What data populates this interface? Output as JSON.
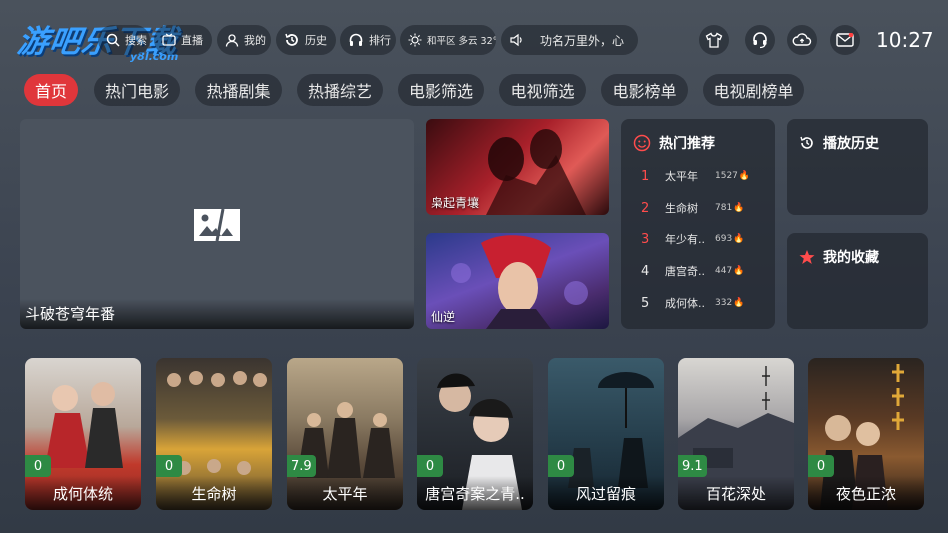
{
  "logo": {
    "main": "游吧乐下载",
    "sub": "y8l.com"
  },
  "topbar": {
    "search_label": "搜索",
    "live_label": "直播",
    "mine_label": "我的",
    "history_label": "历史",
    "rank_label": "排行",
    "weather_label": "和平区 多云 32°",
    "notice_text": "功名万里外，心"
  },
  "clock": "10:27",
  "nav": [
    {
      "label": "首页"
    },
    {
      "label": "热门电影"
    },
    {
      "label": "热播剧集"
    },
    {
      "label": "热播综艺"
    },
    {
      "label": "电影筛选"
    },
    {
      "label": "电视筛选"
    },
    {
      "label": "电影榜单"
    },
    {
      "label": "电视剧榜单"
    }
  ],
  "feature": {
    "caption": "斗破苍穹年番"
  },
  "thumbs": [
    {
      "caption": "枭起青壤"
    },
    {
      "caption": "仙逆"
    }
  ],
  "hot": {
    "title": "热门推荐",
    "items": [
      {
        "rank": "1",
        "name": "太平年",
        "count": "1527"
      },
      {
        "rank": "2",
        "name": "生命树",
        "count": "781"
      },
      {
        "rank": "3",
        "name": "年少有..",
        "count": "693"
      },
      {
        "rank": "4",
        "name": "唐宫奇..",
        "count": "447"
      },
      {
        "rank": "5",
        "name": "成何体..",
        "count": "332"
      }
    ]
  },
  "history_panel": {
    "title": "播放历史"
  },
  "favorites_panel": {
    "title": "我的收藏"
  },
  "posters": [
    {
      "title": "成何体统",
      "score": "0"
    },
    {
      "title": "生命树",
      "score": "0"
    },
    {
      "title": "太平年",
      "score": "7.9"
    },
    {
      "title": "唐宫奇案之青..",
      "score": "0"
    },
    {
      "title": "风过留痕",
      "score": "0"
    },
    {
      "title": "百花深处",
      "score": "9.1"
    },
    {
      "title": "夜色正浓",
      "score": "0"
    }
  ],
  "colors": {
    "accent": "#e0363b",
    "score_bg": "#2e8a44"
  }
}
